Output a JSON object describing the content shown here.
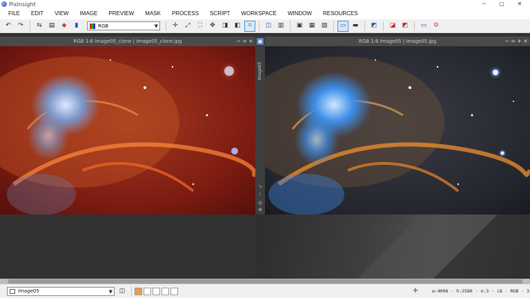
{
  "app": {
    "title": "PixInsight"
  },
  "window_controls": {
    "minimize": "─",
    "maximize": "▢",
    "close": "✕"
  },
  "menu": [
    "FILE",
    "EDIT",
    "VIEW",
    "IMAGE",
    "PREVIEW",
    "MASK",
    "PROCESS",
    "SCRIPT",
    "WORKSPACE",
    "WINDOW",
    "RESOURCES"
  ],
  "toolbar": {
    "color_space_value": "RGB",
    "icons": [
      "undo-icon",
      "redo-icon",
      "reset-icon",
      "invert-icon",
      "color-icon",
      "channel-icon"
    ]
  },
  "windows": [
    {
      "title": "RGB 1:6 Image05_clone | Image05_clone.jpg"
    },
    {
      "title": "RGB 1:6 Image05 | Image05.jpg"
    }
  ],
  "side_tab": {
    "label": "Image05"
  },
  "status": {
    "view_value": "Image05",
    "info": "w:4096 · h:2580 · n:3 · i8 · RGB · 3"
  },
  "colors": {
    "accent": "#4a8cd8",
    "workspace": "#323232",
    "titlebar": "#4a4a4a"
  }
}
